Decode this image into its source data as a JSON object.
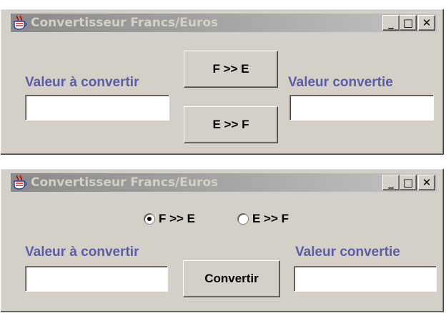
{
  "window_top": {
    "title": "Convertisseur Francs/Euros",
    "controls": {
      "minimize": "_",
      "maximize": "□",
      "close": "✕"
    },
    "input_label": "Valeur à convertir",
    "output_label": "Valeur convertie",
    "button_f_to_e": "F >> E",
    "button_e_to_f": "E >> F",
    "input_value": "",
    "output_value": ""
  },
  "window_bottom": {
    "title": "Convertisseur Francs/Euros",
    "controls": {
      "minimize": "_",
      "maximize": "□",
      "close": "✕"
    },
    "radio_f_to_e": "F >> E",
    "radio_e_to_f": "E >> F",
    "selected": "F >> E",
    "input_label": "Valeur à convertir",
    "output_label": "Valeur convertie",
    "convert_button": "Convertir",
    "input_value": "",
    "output_value": ""
  }
}
